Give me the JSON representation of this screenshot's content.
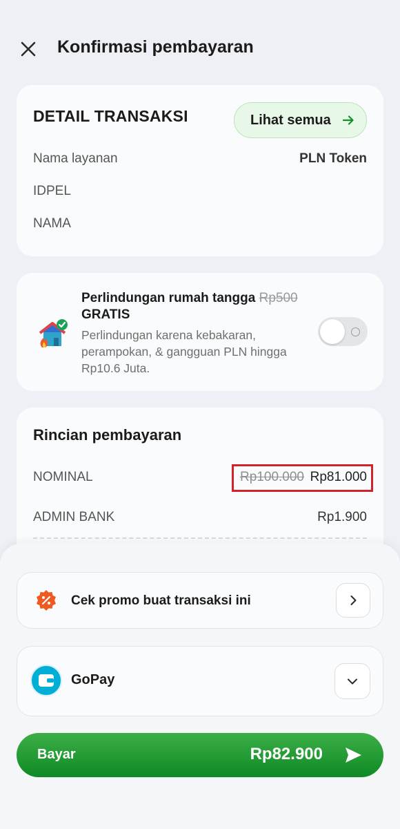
{
  "header": {
    "title": "Konfirmasi pembayaran"
  },
  "detail": {
    "heading": "DETAIL TRANSAKSI",
    "see_all_label": "Lihat semua",
    "rows": [
      {
        "label": "Nama layanan",
        "value": "PLN Token"
      },
      {
        "label": "IDPEL",
        "value": ""
      },
      {
        "label": "NAMA",
        "value": ""
      }
    ]
  },
  "insurance": {
    "title": "Perlindungan rumah tangga",
    "old_price": "Rp500",
    "free_label": "GRATIS",
    "description": "Perlindungan karena kebakaran, perampokan, & gangguan PLN hingga Rp10.6 Juta.",
    "enabled": false
  },
  "rincian": {
    "heading": "Rincian pembayaran",
    "nominal_label": "NOMINAL",
    "nominal_old": "Rp100.000",
    "nominal_new": "Rp81.000",
    "admin_label": "ADMIN BANK",
    "admin_value": "Rp1.900"
  },
  "promo": {
    "label": "Cek promo buat transaksi ini"
  },
  "payment_method": {
    "label": "GoPay"
  },
  "pay_button": {
    "label": "Bayar",
    "amount": "Rp82.900"
  },
  "colors": {
    "primary_green": "#0f8a24",
    "highlight_red": "#d3232a",
    "promo_orange": "#ee5a1f",
    "gopay_blue": "#00aed6"
  }
}
